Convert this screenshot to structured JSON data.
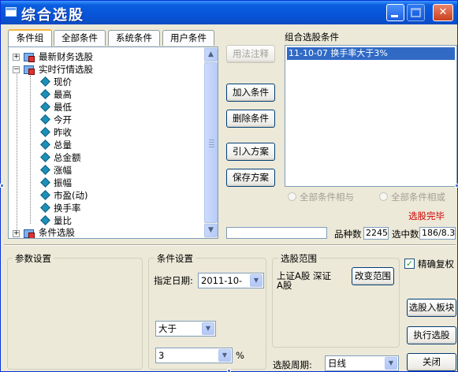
{
  "window": {
    "title": "综合选股"
  },
  "tabs": [
    {
      "label": "条件组",
      "active": true
    },
    {
      "label": "全部条件",
      "active": false
    },
    {
      "label": "系统条件",
      "active": false
    },
    {
      "label": "用户条件",
      "active": false
    }
  ],
  "tree": {
    "groups": [
      {
        "label": "最新财务选股",
        "expanded": false
      },
      {
        "label": "实时行情选股",
        "expanded": true
      },
      {
        "label": "条件选股",
        "expanded": false
      }
    ],
    "items": [
      "现价",
      "最高",
      "最低",
      "今开",
      "昨收",
      "总量",
      "总金额",
      "涨幅",
      "振幅",
      "市盈(动)",
      "换手率",
      "量比"
    ]
  },
  "buttons": {
    "annotate": "用法注释",
    "add": "加入条件",
    "delete": "删除条件",
    "import": "引入方案",
    "save": "保存方案",
    "change_range": "改变范围",
    "to_board": "选股入板块",
    "execute": "执行选股",
    "close": "关闭"
  },
  "combined": {
    "title": "组合选股条件",
    "conditions": [
      "11-10-07 换手率大于3%"
    ],
    "radio_and": "全部条件相与",
    "radio_or": "全部条件相或",
    "status": "选股完毕",
    "count_label": "品种数",
    "count_value": "2245",
    "selected_label": "选中数",
    "selected_value": "186/8.3"
  },
  "params": {
    "title": "参数设置"
  },
  "condition_settings": {
    "title": "条件设置",
    "date_label": "指定日期:",
    "date_value": "2011-10-",
    "operator": "大于",
    "value": "3",
    "unit": "%"
  },
  "stock_range": {
    "title": "选股范围",
    "line1": "上证A股 深证",
    "line2": "A股"
  },
  "options": {
    "precise_label": "精确复权",
    "precise_checked": true
  },
  "period": {
    "label": "选股周期:",
    "value": "日线"
  },
  "colors": {
    "title_bar": "#0854d8",
    "selection": "#316ac5",
    "status": "#d00000"
  }
}
